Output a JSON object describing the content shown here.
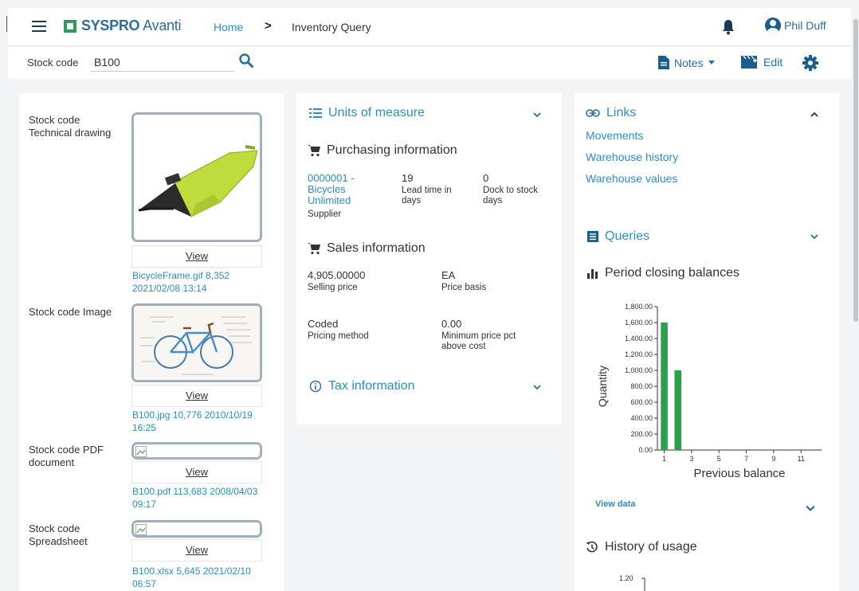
{
  "header": {
    "logo_brand": "SYSPRO",
    "logo_product": "Avanti",
    "breadcrumb_home": "Home",
    "breadcrumb_sep": ">",
    "breadcrumb_current": "Inventory Query",
    "user_name": "Phil Duff"
  },
  "toolbar": {
    "stock_code_label": "Stock code",
    "stock_code_value": "B100",
    "notes_label": "Notes",
    "edit_label": "Edit"
  },
  "attachments": [
    {
      "label": "Stock code Technical drawing",
      "view": "View",
      "meta": "BicycleFrame.gif 8,352 2021/02/08 13:14"
    },
    {
      "label": "Stock code Image",
      "view": "View",
      "meta": "B100.jpg 10,776 2010/10/19 16:25"
    },
    {
      "label": "Stock code PDF document",
      "view": "View",
      "meta": "B100.pdf 113,683 2008/04/03 09:17"
    },
    {
      "label": "Stock code Spreadsheet",
      "view": "View",
      "meta": "B100.xlsx 5,645 2021/02/10 06:57"
    }
  ],
  "middle": {
    "units_title": "Units of measure",
    "purchasing_title": "Purchasing information",
    "supplier_value": "0000001 - Bicycles Unlimited",
    "supplier_label": "Supplier",
    "lead_time_value": "19",
    "lead_time_label": "Lead time in days",
    "dock_value": "0",
    "dock_label": "Dock to stock days",
    "sales_title": "Sales information",
    "selling_price_value": "4,905.00000",
    "selling_price_label": "Selling price",
    "price_basis_value": "EA",
    "price_basis_label": "Price basis",
    "pricing_method_value": "Coded",
    "pricing_method_label": "Pricing method",
    "min_price_value": "0.00",
    "min_price_label": "Minimum price pct above cost",
    "tax_title": "Tax information"
  },
  "right": {
    "links_title": "Links",
    "links": [
      "Movements",
      "Warehouse history",
      "Warehouse values"
    ],
    "queries_title": "Queries",
    "period_title": "Period closing balances",
    "view_data": "View data",
    "history_title": "History of usage",
    "history_first_tick": "1.20"
  },
  "chart_data": {
    "type": "bar",
    "title": "",
    "xlabel": "Previous balance",
    "ylabel": "Quantity",
    "x": [
      1,
      2,
      3,
      4,
      5,
      6,
      7,
      8,
      9,
      10,
      11,
      12
    ],
    "x_tick_labels": [
      "1",
      "3",
      "5",
      "7",
      "9",
      "11"
    ],
    "values": [
      1600,
      1000,
      0,
      0,
      0,
      0,
      0,
      0,
      0,
      0,
      0,
      0
    ],
    "ylim": [
      0,
      1800
    ],
    "y_tick_labels": [
      "0.00",
      "200.00",
      "400.00",
      "600.00",
      "800.00",
      "1,000.00",
      "1,200.00",
      "1,400.00",
      "1,600.00",
      "1,800.00"
    ],
    "color": "#2aa04a"
  }
}
